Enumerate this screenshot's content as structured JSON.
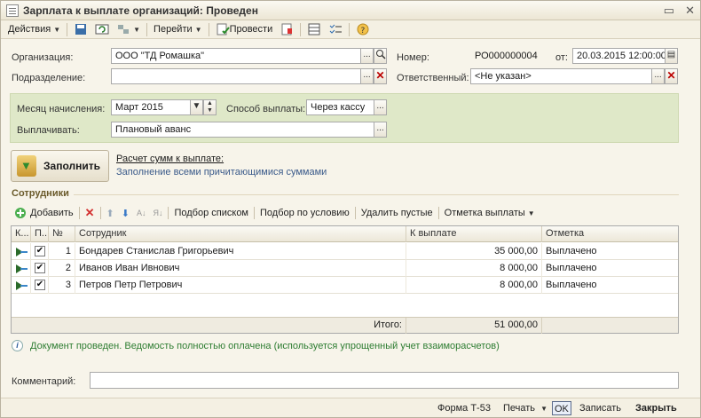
{
  "window": {
    "title": "Зарплата к выплате организаций: Проведен"
  },
  "toolbar": {
    "actions_label": "Действия",
    "go_label": "Перейти",
    "post_label": "Провести"
  },
  "form": {
    "organization_label": "Организация:",
    "organization_value": "ООО \"ТД Ромашка\"",
    "department_label": "Подразделение:",
    "department_value": "",
    "number_label": "Номер:",
    "number_value": "РО000000004",
    "date_label": "от:",
    "date_value": "20.03.2015 12:00:00",
    "responsible_label": "Ответственный:",
    "responsible_value": "<Не указан>",
    "month_label": "Месяц начисления:",
    "month_value": "Март 2015",
    "payment_method_label": "Способ выплаты:",
    "payment_method_value": "Через кассу",
    "pay_label": "Выплачивать:",
    "pay_value": "Плановый аванс"
  },
  "fill": {
    "button_label": "Заполнить",
    "link_calc": "Расчет сумм к выплате:",
    "link_fill_all": "Заполнение всеми причитающимися суммами"
  },
  "employees": {
    "section_title": "Сотрудники",
    "toolbar": {
      "add_label": "Добавить",
      "pick_list_label": "Подбор списком",
      "pick_condition_label": "Подбор по условию",
      "delete_empty_label": "Удалить пустые",
      "payment_mark_label": "Отметка выплаты"
    },
    "columns": [
      "К...",
      "П...",
      "№",
      "Сотрудник",
      "К выплате",
      "Отметка"
    ],
    "rows": [
      {
        "n": "1",
        "name": "Бондарев Станислав Григорьевич",
        "amount": "35 000,00",
        "mark": "Выплачено",
        "checked": true
      },
      {
        "n": "2",
        "name": "Иванов Иван Ивнович",
        "amount": "8 000,00",
        "mark": "Выплачено",
        "checked": true
      },
      {
        "n": "3",
        "name": "Петров Петр Петрович",
        "amount": "8 000,00",
        "mark": "Выплачено",
        "checked": true
      }
    ],
    "total_label": "Итого:",
    "total_value": "51 000,00"
  },
  "info": {
    "message": "Документ проведен. Ведомость полностью оплачена (используется упрощенный учет взаиморасчетов)"
  },
  "comment": {
    "label": "Комментарий:",
    "value": ""
  },
  "bottom": {
    "form_label": "Форма Т-53",
    "print_label": "Печать",
    "ok_label": "OK",
    "save_label": "Записать",
    "close_label": "Закрыть"
  }
}
